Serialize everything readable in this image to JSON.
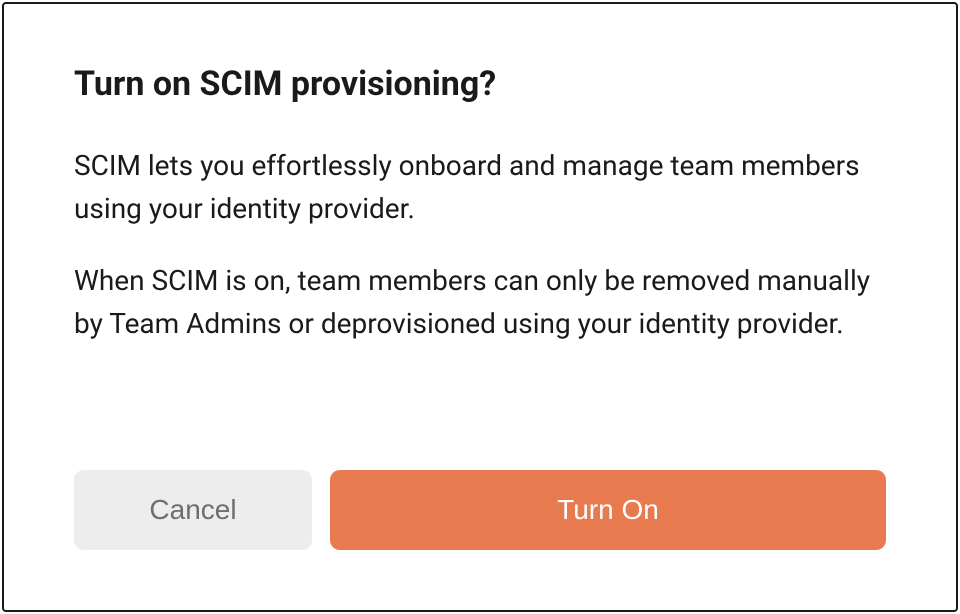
{
  "dialog": {
    "title": "Turn on SCIM provisioning?",
    "paragraph1": "SCIM lets you effortlessly onboard and manage team members using your identity provider.",
    "paragraph2": "When SCIM is on, team members can only be removed manually by Team Admins or deprovisioned using your identity provider.",
    "cancel_label": "Cancel",
    "confirm_label": "Turn On"
  }
}
